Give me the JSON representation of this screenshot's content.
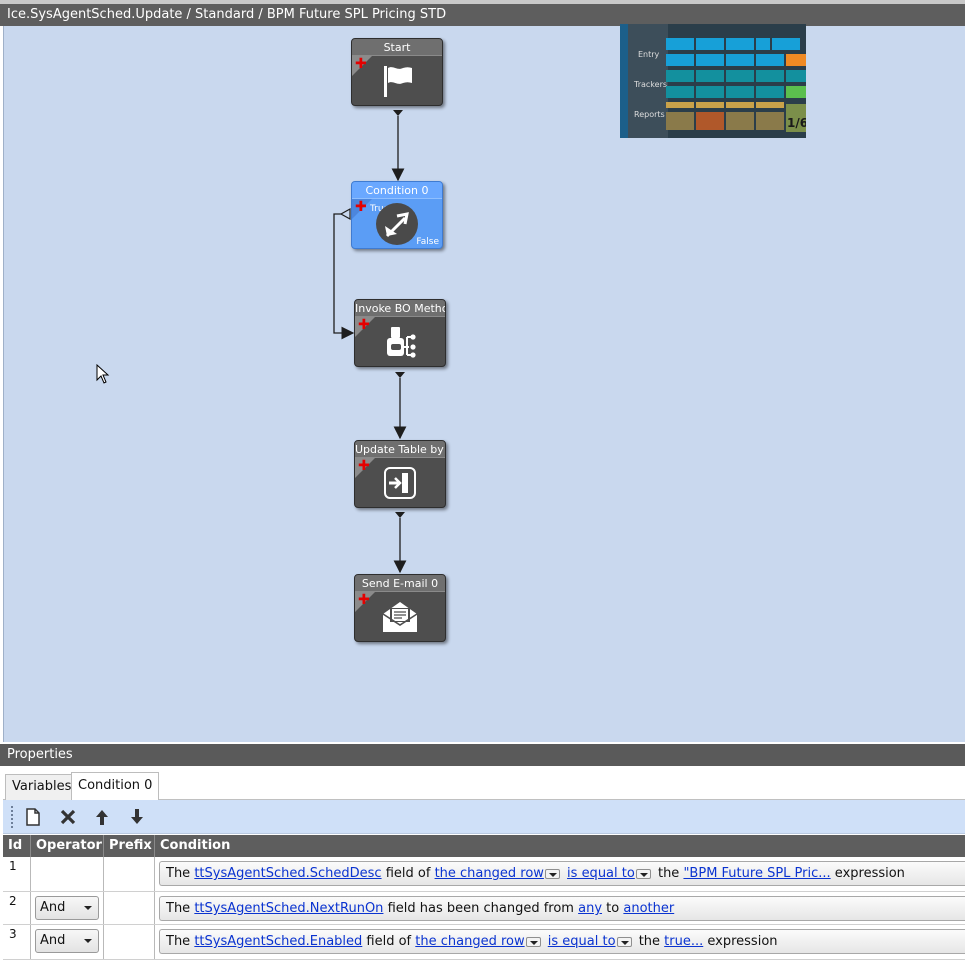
{
  "window": {
    "title": "Ice.SysAgentSched.Update / Standard / BPM Future SPL Pricing STD"
  },
  "workflow": {
    "start": {
      "title": "Start",
      "icon": "flag-icon"
    },
    "condition": {
      "title": "Condition 0",
      "true_label": "True",
      "false_label": "False",
      "icon": "condition-arrows-icon"
    },
    "invoke": {
      "title": "Invoke BO Method",
      "icon": "invoke-bo-method-icon"
    },
    "update": {
      "title": "Update Table by Q",
      "icon": "update-table-icon"
    },
    "email": {
      "title": "Send E-mail 0",
      "icon": "envelope-icon"
    }
  },
  "minimap": {
    "labels": [
      "Entry",
      "Trackers",
      "Reports"
    ],
    "page": "1/6"
  },
  "properties": {
    "header": "Properties",
    "tabs": [
      "Variables",
      "Condition 0"
    ],
    "active_tab": "Condition 0",
    "toolbar": [
      "new-icon",
      "delete-icon",
      "move-up-icon",
      "move-down-icon"
    ],
    "columns": [
      "Id",
      "Operator",
      "Prefix",
      "Condition"
    ],
    "rows": [
      {
        "id": "1",
        "operator": "",
        "prefix": "",
        "t1": "The",
        "field": "ttSysAgentSched.SchedDesc",
        "t2": "field of",
        "scope": "the changed row",
        "op": "is equal to",
        "t3": "the",
        "value": "\"BPM Future SPL Pric...",
        "t4": "expression"
      },
      {
        "id": "2",
        "operator": "And",
        "prefix": "",
        "t1": "The",
        "field": "ttSysAgentSched.NextRunOn",
        "t2": "field has been changed from",
        "from": "any",
        "t3": "to",
        "to": "another"
      },
      {
        "id": "3",
        "operator": "And",
        "prefix": "",
        "t1": "The",
        "field": "ttSysAgentSched.Enabled",
        "t2": "field of",
        "scope": "the changed row",
        "op": "is equal to",
        "t3": "the",
        "value": "true...",
        "t4": "expression"
      }
    ]
  },
  "colors": {
    "canvas": "#c9d8ee",
    "node": "#4e4e4e",
    "node_selected": "#5b9df5",
    "link": "#0a33d0"
  }
}
